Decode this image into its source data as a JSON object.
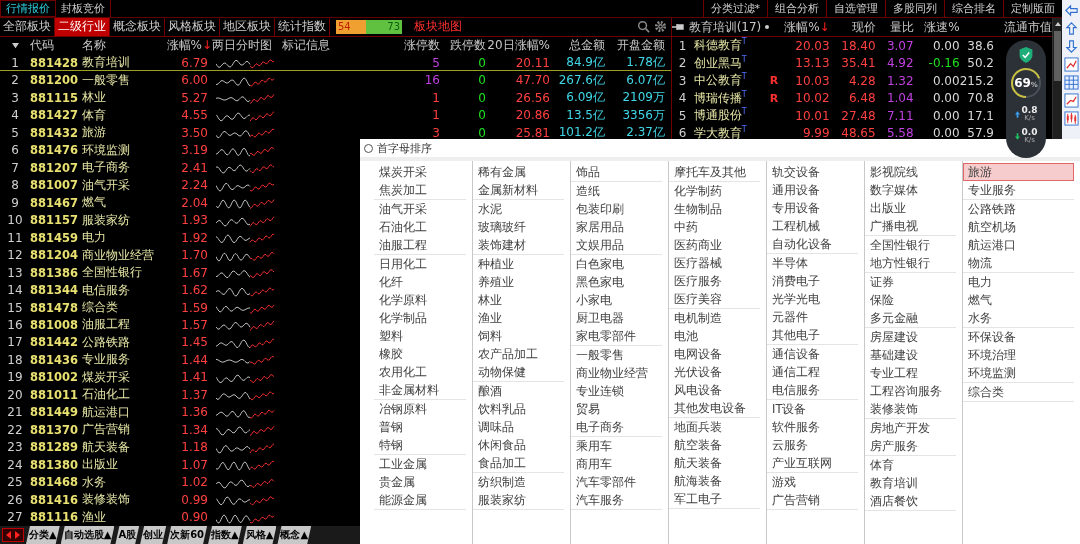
{
  "menu_bar": {
    "left": [
      {
        "label": "行情报价",
        "selected": true
      },
      {
        "label": "封板竞价",
        "selected": false
      }
    ],
    "right": [
      "分类过滤*",
      "组合分析",
      "自选管理",
      "多股同列",
      "综合排名",
      "定制版面"
    ]
  },
  "tabs": [
    {
      "label": "全部板块",
      "selected": false
    },
    {
      "label": "二级行业",
      "selected": true
    },
    {
      "label": "概念板块",
      "selected": false
    },
    {
      "label": "风格板块",
      "selected": false
    },
    {
      "label": "地区板块",
      "selected": false
    },
    {
      "label": "统计指数",
      "selected": false
    }
  ],
  "breadth": {
    "up": "54",
    "down": "73",
    "level": 0.43
  },
  "map_link": "板块地图",
  "table": {
    "columns": [
      {
        "label": "代码"
      },
      {
        "label": "名称"
      },
      {
        "label": "涨幅%",
        "sort_arrow": "↓"
      },
      {
        "label": "两日分时图"
      },
      {
        "label": "标记信息"
      },
      {
        "label": "涨停数"
      },
      {
        "label": "跌停数"
      },
      {
        "label": "20日涨幅%"
      },
      {
        "label": "总金额"
      },
      {
        "label": "开盘金额"
      }
    ],
    "rows": [
      {
        "rank": "1",
        "code": "881428",
        "name": "教育培训",
        "change": "6.79",
        "selected": true,
        "limit_up": {
          "text": "5",
          "color": "#c040e0"
        },
        "limit_down": "0",
        "change_20d": "20.11",
        "total": "84.9亿",
        "open_amount": "1.78亿"
      },
      {
        "rank": "2",
        "code": "881200",
        "name": "一般零售",
        "change": "6.00",
        "selected": false,
        "limit_up": {
          "text": "16",
          "color": "#c040e0"
        },
        "limit_down": "0",
        "change_20d": "47.70",
        "total": "267.6亿",
        "open_amount": "6.07亿"
      },
      {
        "rank": "3",
        "code": "881115",
        "name": "林业",
        "change": "5.27",
        "selected": false,
        "limit_up": {
          "text": "1",
          "color": "#ff4040"
        },
        "limit_down": "0",
        "change_20d": "26.56",
        "total": "6.09亿",
        "open_amount": "2109万"
      },
      {
        "rank": "4",
        "code": "881427",
        "name": "体育",
        "change": "4.55",
        "selected": false,
        "limit_up": {
          "text": "1",
          "color": "#ff4040"
        },
        "limit_down": "0",
        "change_20d": "20.86",
        "total": "13.5亿",
        "open_amount": "3356万"
      },
      {
        "rank": "5",
        "code": "881432",
        "name": "旅游",
        "change": "3.50",
        "selected": false,
        "limit_up": {
          "text": "3",
          "color": "#ff4040"
        },
        "limit_down": "0",
        "change_20d": "25.81",
        "total": "101.2亿",
        "open_amount": "2.37亿"
      },
      {
        "rank": "6",
        "code": "881476",
        "name": "环境监测",
        "change": "3.19",
        "selected": false
      },
      {
        "rank": "7",
        "code": "881207",
        "name": "电子商务",
        "change": "2.41",
        "selected": false
      },
      {
        "rank": "8",
        "code": "881007",
        "name": "油气开采",
        "change": "2.24",
        "selected": false
      },
      {
        "rank": "9",
        "code": "881467",
        "name": "燃气",
        "change": "2.04",
        "selected": false
      },
      {
        "rank": "10",
        "code": "881157",
        "name": "服装家纺",
        "change": "1.93",
        "selected": false
      },
      {
        "rank": "11",
        "code": "881459",
        "name": "电力",
        "change": "1.92",
        "selected": false
      },
      {
        "rank": "12",
        "code": "881204",
        "name": "商业物业经营",
        "change": "1.70",
        "selected": false
      },
      {
        "rank": "13",
        "code": "881386",
        "name": "全国性银行",
        "change": "1.67",
        "selected": false
      },
      {
        "rank": "14",
        "code": "881344",
        "name": "电信服务",
        "change": "1.62",
        "selected": false
      },
      {
        "rank": "15",
        "code": "881478",
        "name": "综合类",
        "change": "1.59",
        "selected": false
      },
      {
        "rank": "16",
        "code": "881008",
        "name": "油服工程",
        "change": "1.57",
        "selected": false
      },
      {
        "rank": "17",
        "code": "881442",
        "name": "公路铁路",
        "change": "1.45",
        "selected": false
      },
      {
        "rank": "18",
        "code": "881436",
        "name": "专业服务",
        "change": "1.44",
        "selected": false
      },
      {
        "rank": "19",
        "code": "881002",
        "name": "煤炭开采",
        "change": "1.41",
        "selected": false
      },
      {
        "rank": "20",
        "code": "881011",
        "name": "石油化工",
        "change": "1.37",
        "selected": false
      },
      {
        "rank": "21",
        "code": "881449",
        "name": "航运港口",
        "change": "1.36",
        "selected": false
      },
      {
        "rank": "22",
        "code": "881370",
        "name": "广告营销",
        "change": "1.34",
        "selected": false
      },
      {
        "rank": "23",
        "code": "881289",
        "name": "航天装备",
        "change": "1.18",
        "selected": false
      },
      {
        "rank": "24",
        "code": "881380",
        "name": "出版业",
        "change": "1.07",
        "selected": false
      },
      {
        "rank": "25",
        "code": "881468",
        "name": "水务",
        "change": "1.02",
        "selected": false
      },
      {
        "rank": "26",
        "code": "881416",
        "name": "装修装饰",
        "change": "0.99",
        "selected": false
      },
      {
        "rank": "27",
        "code": "881116",
        "name": "渔业",
        "change": "0.90",
        "selected": false
      }
    ]
  },
  "bottom_tabs": [
    "分类▲",
    "自动选股▲",
    "A股",
    "创业",
    "次新60",
    "指数▲",
    "风格▲",
    "概念▲"
  ],
  "sector_panel": {
    "title": "教育培训(17)",
    "columns": [
      {
        "label": "涨幅%",
        "sort_arrow": "↓"
      },
      {
        "label": "现价"
      },
      {
        "label": "量比"
      },
      {
        "label": "涨速%"
      },
      {
        "label": "流通市值"
      }
    ],
    "rows": [
      {
        "rank": "1",
        "name": "科德教育",
        "tag": "T",
        "change": "20.03",
        "price": "18.40",
        "volume_ratio": "3.07",
        "speed": {
          "text": "0.00",
          "color": "#d8d8d8"
        },
        "market_cap": "38.6"
      },
      {
        "rank": "2",
        "name": "创业黑马",
        "tag": "T",
        "change": "13.13",
        "price": "35.41",
        "volume_ratio": "4.92",
        "speed": {
          "text": "-0.16",
          "color": "#20e020"
        },
        "market_cap": "50.2"
      },
      {
        "rank": "3",
        "name": "中公教育",
        "tag": "T",
        "flag": "R",
        "change": "10.03",
        "price": "4.28",
        "volume_ratio": "1.32",
        "speed": {
          "text": "0.00",
          "color": "#d8d8d8"
        },
        "market_cap": "215.2"
      },
      {
        "rank": "4",
        "name": "博瑞传播",
        "tag": "T",
        "flag": "R",
        "change": "10.02",
        "price": "6.48",
        "volume_ratio": "1.04",
        "speed": {
          "text": "0.00",
          "color": "#d8d8d8"
        },
        "market_cap": "70.8"
      },
      {
        "rank": "5",
        "name": "博通股份",
        "tag": "T",
        "change": "10.01",
        "price": "27.48",
        "volume_ratio": "7.11",
        "speed": {
          "text": "0.00",
          "color": "#d8d8d8"
        },
        "market_cap": "17.1"
      },
      {
        "rank": "6",
        "name": "学大教育",
        "tag": "T",
        "change": "9.99",
        "price": "48.65",
        "volume_ratio": "5.58",
        "speed": {
          "text": "0.00",
          "color": "#d8d8d8"
        },
        "market_cap": "57.9"
      }
    ]
  },
  "popup": {
    "radio_label": "首字母排序",
    "radio_checked": false,
    "columns": [
      [
        [
          {
            "label": "煤炭开采",
            "selected": false
          },
          {
            "label": "焦炭加工",
            "selected": false
          }
        ],
        [
          {
            "label": "油气开采",
            "selected": false
          },
          {
            "label": "石油化工",
            "selected": false
          },
          {
            "label": "油服工程",
            "selected": false
          }
        ],
        [
          {
            "label": "日用化工",
            "selected": false
          },
          {
            "label": "化纤",
            "selected": false
          },
          {
            "label": "化学原料",
            "selected": false
          },
          {
            "label": "化学制品",
            "selected": false
          },
          {
            "label": "塑料",
            "selected": false
          },
          {
            "label": "橡胶",
            "selected": false
          },
          {
            "label": "农用化工",
            "selected": false
          },
          {
            "label": "非金属材料",
            "selected": false
          }
        ],
        [
          {
            "label": "冶钢原料",
            "selected": false
          },
          {
            "label": "普钢",
            "selected": false
          },
          {
            "label": "特钢",
            "selected": false
          }
        ],
        [
          {
            "label": "工业金属",
            "selected": false
          },
          {
            "label": "贵金属",
            "selected": false
          },
          {
            "label": "能源金属",
            "selected": false
          }
        ]
      ],
      [
        [
          {
            "label": "稀有金属",
            "selected": false
          },
          {
            "label": "金属新材料",
            "selected": false
          }
        ],
        [
          {
            "label": "水泥",
            "selected": false
          },
          {
            "label": "玻璃玻纤",
            "selected": false
          },
          {
            "label": "装饰建材",
            "selected": false
          }
        ],
        [
          {
            "label": "种植业",
            "selected": false
          },
          {
            "label": "养殖业",
            "selected": false
          },
          {
            "label": "林业",
            "selected": false
          },
          {
            "label": "渔业",
            "selected": false
          },
          {
            "label": "饲料",
            "selected": false
          },
          {
            "label": "农产品加工",
            "selected": false
          },
          {
            "label": "动物保健",
            "selected": false
          }
        ],
        [
          {
            "label": "酿酒",
            "selected": false
          },
          {
            "label": "饮料乳品",
            "selected": false
          },
          {
            "label": "调味品",
            "selected": false
          },
          {
            "label": "休闲食品",
            "selected": false
          },
          {
            "label": "食品加工",
            "selected": false
          }
        ],
        [
          {
            "label": "纺织制造",
            "selected": false
          },
          {
            "label": "服装家纺",
            "selected": false
          }
        ]
      ],
      [
        [
          {
            "label": "饰品",
            "selected": false
          }
        ],
        [
          {
            "label": "造纸",
            "selected": false
          },
          {
            "label": "包装印刷",
            "selected": false
          },
          {
            "label": "家居用品",
            "selected": false
          },
          {
            "label": "文娱用品",
            "selected": false
          }
        ],
        [
          {
            "label": "白色家电",
            "selected": false
          },
          {
            "label": "黑色家电",
            "selected": false
          },
          {
            "label": "小家电",
            "selected": false
          },
          {
            "label": "厨卫电器",
            "selected": false
          },
          {
            "label": "家电零部件",
            "selected": false
          }
        ],
        [
          {
            "label": "一般零售",
            "selected": false
          },
          {
            "label": "商业物业经营",
            "selected": false
          },
          {
            "label": "专业连锁",
            "selected": false
          },
          {
            "label": "贸易",
            "selected": false
          },
          {
            "label": "电子商务",
            "selected": false
          }
        ],
        [
          {
            "label": "乘用车",
            "selected": false
          },
          {
            "label": "商用车",
            "selected": false
          },
          {
            "label": "汽车零部件",
            "selected": false
          },
          {
            "label": "汽车服务",
            "selected": false
          }
        ]
      ],
      [
        [
          {
            "label": "摩托车及其他",
            "selected": false
          }
        ],
        [
          {
            "label": "化学制药",
            "selected": false
          },
          {
            "label": "生物制品",
            "selected": false
          },
          {
            "label": "中药",
            "selected": false
          },
          {
            "label": "医药商业",
            "selected": false
          },
          {
            "label": "医疗器械",
            "selected": false
          },
          {
            "label": "医疗服务",
            "selected": false
          },
          {
            "label": "医疗美容",
            "selected": false
          }
        ],
        [
          {
            "label": "电机制造",
            "selected": false
          },
          {
            "label": "电池",
            "selected": false
          },
          {
            "label": "电网设备",
            "selected": false
          },
          {
            "label": "光伏设备",
            "selected": false
          },
          {
            "label": "风电设备",
            "selected": false
          },
          {
            "label": "其他发电设备",
            "selected": false
          }
        ],
        [
          {
            "label": "地面兵装",
            "selected": false
          },
          {
            "label": "航空装备",
            "selected": false
          },
          {
            "label": "航天装备",
            "selected": false
          },
          {
            "label": "航海装备",
            "selected": false
          },
          {
            "label": "军工电子",
            "selected": false
          }
        ]
      ],
      [
        [
          {
            "label": "轨交设备",
            "selected": false
          },
          {
            "label": "通用设备",
            "selected": false
          },
          {
            "label": "专用设备",
            "selected": false
          },
          {
            "label": "工程机械",
            "selected": false
          },
          {
            "label": "自动化设备",
            "selected": false
          }
        ],
        [
          {
            "label": "半导体",
            "selected": false
          },
          {
            "label": "消费电子",
            "selected": false
          },
          {
            "label": "光学光电",
            "selected": false
          },
          {
            "label": "元器件",
            "selected": false
          },
          {
            "label": "其他电子",
            "selected": false
          }
        ],
        [
          {
            "label": "通信设备",
            "selected": false
          },
          {
            "label": "通信工程",
            "selected": false
          },
          {
            "label": "电信服务",
            "selected": false
          }
        ],
        [
          {
            "label": "IT设备",
            "selected": false
          },
          {
            "label": "软件服务",
            "selected": false
          },
          {
            "label": "云服务",
            "selected": false
          },
          {
            "label": "产业互联网",
            "selected": false
          }
        ],
        [
          {
            "label": "游戏",
            "selected": false
          },
          {
            "label": "广告营销",
            "selected": false
          }
        ]
      ],
      [
        [
          {
            "label": "影视院线",
            "selected": false
          },
          {
            "label": "数字媒体",
            "selected": false
          },
          {
            "label": "出版业",
            "selected": false
          },
          {
            "label": "广播电视",
            "selected": false
          }
        ],
        [
          {
            "label": "全国性银行",
            "selected": false
          },
          {
            "label": "地方性银行",
            "selected": false
          }
        ],
        [
          {
            "label": "证券",
            "selected": false
          },
          {
            "label": "保险",
            "selected": false
          },
          {
            "label": "多元金融",
            "selected": false
          }
        ],
        [
          {
            "label": "房屋建设",
            "selected": false
          },
          {
            "label": "基础建设",
            "selected": false
          },
          {
            "label": "专业工程",
            "selected": false
          },
          {
            "label": "工程咨询服务",
            "selected": false
          },
          {
            "label": "装修装饰",
            "selected": false
          }
        ],
        [
          {
            "label": "房地产开发",
            "selected": false
          },
          {
            "label": "房产服务",
            "selected": false
          }
        ],
        [
          {
            "label": "体育",
            "selected": false
          },
          {
            "label": "教育培训",
            "selected": false
          },
          {
            "label": "酒店餐饮",
            "selected": false
          }
        ]
      ],
      [
        [
          {
            "label": "旅游",
            "selected": true
          },
          {
            "label": "专业服务",
            "selected": false
          }
        ],
        [
          {
            "label": "公路铁路",
            "selected": false
          },
          {
            "label": "航空机场",
            "selected": false
          },
          {
            "label": "航运港口",
            "selected": false
          },
          {
            "label": "物流",
            "selected": false
          }
        ],
        [
          {
            "label": "电力",
            "selected": false
          },
          {
            "label": "燃气",
            "selected": false
          },
          {
            "label": "水务",
            "selected": false
          }
        ],
        [
          {
            "label": "环保设备",
            "selected": false
          },
          {
            "label": "环境治理",
            "selected": false
          },
          {
            "label": "环境监测",
            "selected": false
          }
        ],
        [
          {
            "label": "综合类",
            "selected": false
          }
        ]
      ]
    ]
  },
  "net_widget": {
    "percent": "69",
    "unit": "%",
    "level": 0.69,
    "upload": "0.8",
    "upload_unit": "K/s",
    "download": "0.0",
    "download_unit": "K/s"
  }
}
